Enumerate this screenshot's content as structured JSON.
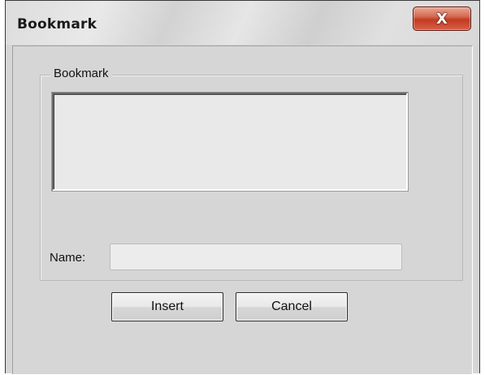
{
  "window": {
    "title": "Bookmark",
    "close_glyph": "X"
  },
  "group": {
    "label": "Bookmark"
  },
  "bookmark_list": {
    "items": []
  },
  "name_field": {
    "label": "Name:",
    "value": "",
    "placeholder": ""
  },
  "buttons": {
    "insert_label": "Insert",
    "cancel_label": "Cancel"
  },
  "icons": {
    "close": "close-icon"
  },
  "colors": {
    "dialog_background": "#d6d6d6",
    "close_button": "#c33b22"
  }
}
